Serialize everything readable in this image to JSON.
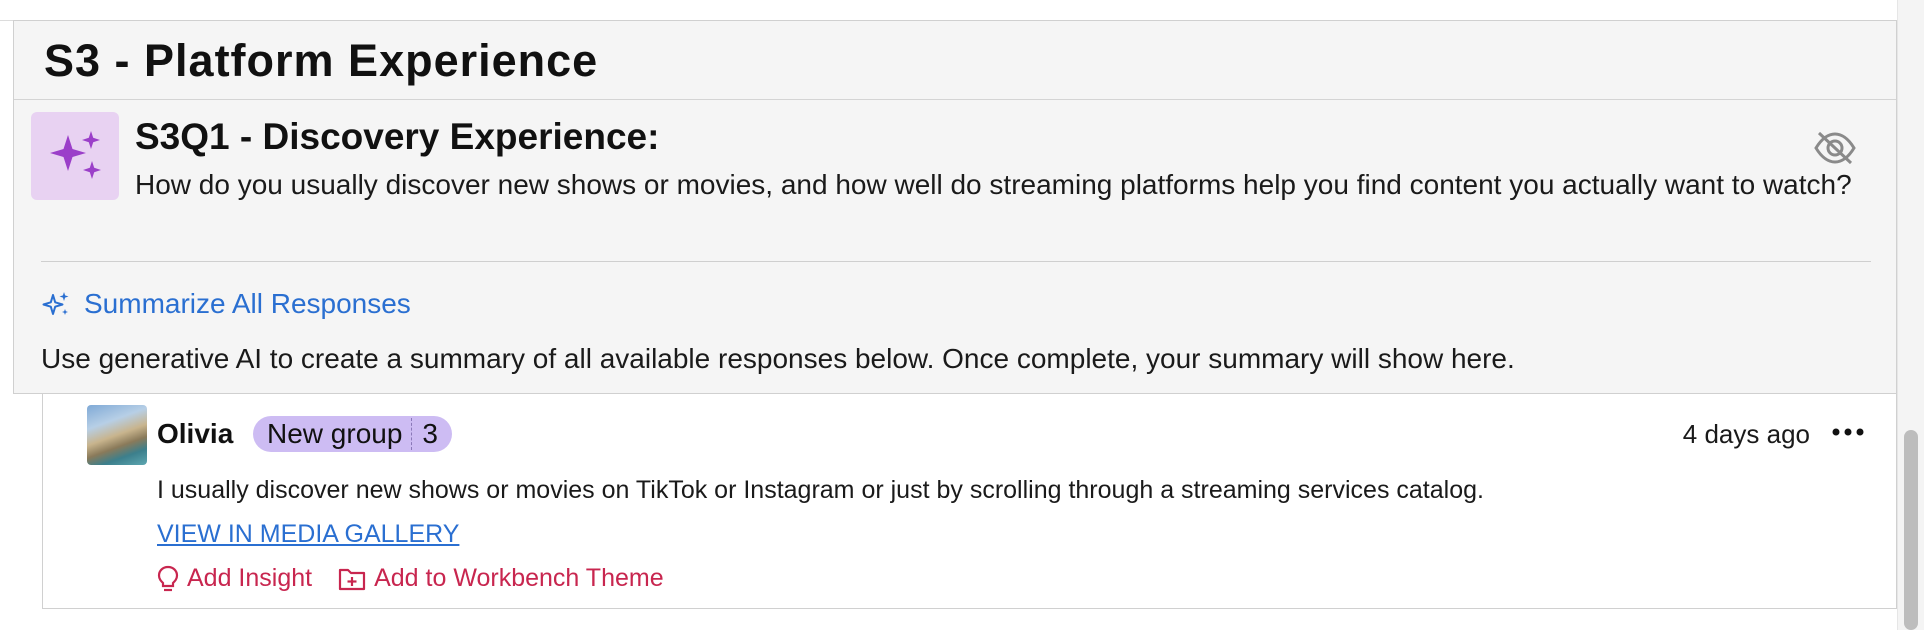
{
  "section": {
    "title": "S3 - Platform Experience"
  },
  "question": {
    "title": "S3Q1 - Discovery Experience:",
    "text": "How do you usually discover new shows or movies, and how well do streaming platforms help you find content you actually want to watch?",
    "badge_icon": "sparkles-icon",
    "badge_color": "#e8d2f2",
    "hide_icon": "eye-off-icon"
  },
  "summary": {
    "button_label": "Summarize All Responses",
    "description": "Use generative AI to create a summary of all available responses below. Once complete, your summary will show here.",
    "accent": "#2a6fd1"
  },
  "response": {
    "author": "Olivia",
    "group_label": "New group",
    "group_count": "3",
    "group_color": "#cdbcf3",
    "time": "4 days ago",
    "text": "I usually discover new shows or movies on TikTok or Instagram or just by scrolling through a streaming services catalog.",
    "gallery_link": "VIEW IN MEDIA GALLERY",
    "actions": {
      "insight": "Add Insight",
      "workbench": "Add to Workbench Theme"
    },
    "action_color": "#c8264f"
  }
}
